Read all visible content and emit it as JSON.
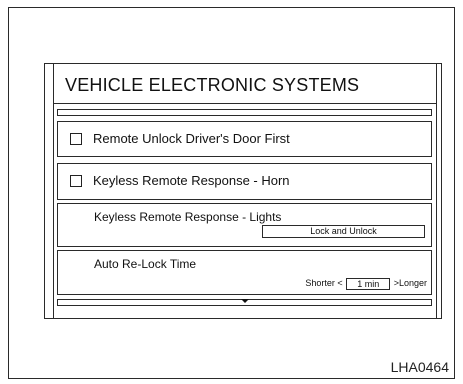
{
  "screen": {
    "title": "VEHICLE ELECTRONIC SYSTEMS"
  },
  "settings": [
    {
      "label": "Remote Unlock Driver's Door First",
      "checked": false
    },
    {
      "label": "Keyless Remote Response - Horn",
      "checked": false
    },
    {
      "label": "Keyless Remote Response - Lights",
      "value": "Lock and Unlock"
    },
    {
      "label": "Auto Re-Lock Time",
      "shorter_label": "Shorter <",
      "value": "1 min",
      "longer_label": ">Longer"
    }
  ],
  "icons": {
    "scroll_down": "down-triangle-icon",
    "checkbox": "checkbox-unchecked-icon"
  },
  "figure_code": "LHA0464"
}
